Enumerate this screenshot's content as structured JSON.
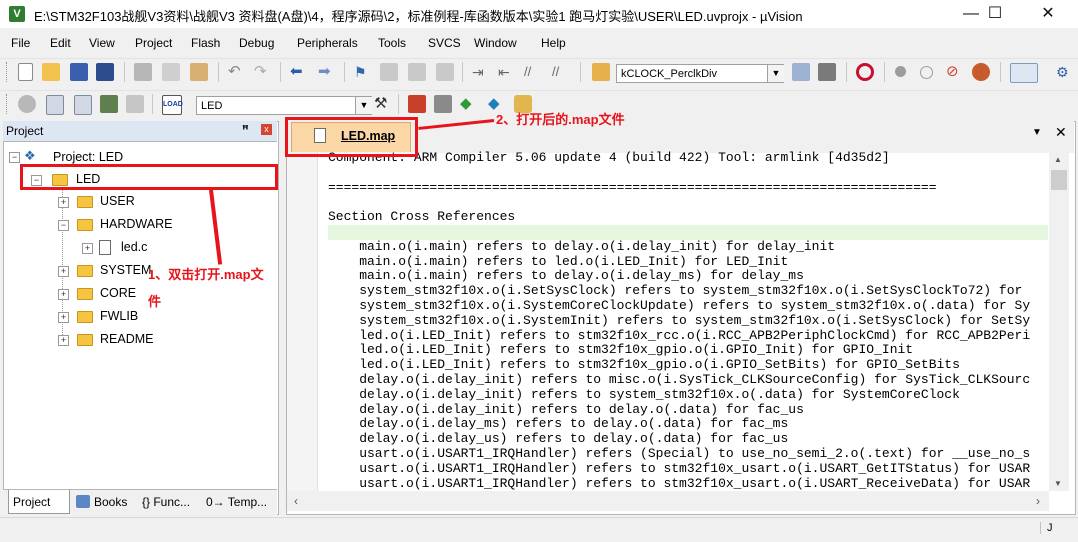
{
  "window": {
    "title": "E:\\STM32F103战舰V3资料\\战舰V3 资料盘(A盘)\\4，程序源码\\2，标准例程-库函数版本\\实验1 跑马灯实验\\USER\\LED.uvprojx - µVision",
    "app_icon_text": "V",
    "minimize": "—",
    "maximize": "☐",
    "close": "✕"
  },
  "menu": [
    "File",
    "Edit",
    "View",
    "Project",
    "Flash",
    "Debug",
    "Peripherals",
    "Tools",
    "SVCS",
    "Window",
    "Help"
  ],
  "toolbar1": {
    "target_combo": "kCLOCK_PerclkDiv"
  },
  "toolbar2": {
    "target_select": "LED",
    "load_label": "LOAD"
  },
  "project_panel": {
    "title": "Project",
    "pin": "ᵦ",
    "close": "x",
    "root": "Project: LED",
    "target": "LED",
    "groups": [
      "USER",
      "HARDWARE",
      "SYSTEM",
      "CORE",
      "FWLIB",
      "README"
    ],
    "hardware_file": "led.c"
  },
  "bottom_tabs": [
    "Project",
    "Books",
    "{} Func...",
    "0→ Temp..."
  ],
  "editor": {
    "tab_label": "LED.map",
    "lines": [
      "Component: ARM Compiler 5.06 update 4 (build 422) Tool: armlink [4d35d2]",
      "",
      "==============================================================================",
      "",
      "Section Cross References",
      "",
      "    main.o(i.main) refers to delay.o(i.delay_init) for delay_init",
      "    main.o(i.main) refers to led.o(i.LED_Init) for LED_Init",
      "    main.o(i.main) refers to delay.o(i.delay_ms) for delay_ms",
      "    system_stm32f10x.o(i.SetSysClock) refers to system_stm32f10x.o(i.SetSysClockTo72) for",
      "    system_stm32f10x.o(i.SystemCoreClockUpdate) refers to system_stm32f10x.o(.data) for Sy",
      "    system_stm32f10x.o(i.SystemInit) refers to system_stm32f10x.o(i.SetSysClock) for SetSy",
      "    led.o(i.LED_Init) refers to stm32f10x_rcc.o(i.RCC_APB2PeriphClockCmd) for RCC_APB2Peri",
      "    led.o(i.LED_Init) refers to stm32f10x_gpio.o(i.GPIO_Init) for GPIO_Init",
      "    led.o(i.LED_Init) refers to stm32f10x_gpio.o(i.GPIO_SetBits) for GPIO_SetBits",
      "    delay.o(i.delay_init) refers to misc.o(i.SysTick_CLKSourceConfig) for SysTick_CLKSourc",
      "    delay.o(i.delay_init) refers to system_stm32f10x.o(.data) for SystemCoreClock",
      "    delay.o(i.delay_init) refers to delay.o(.data) for fac_us",
      "    delay.o(i.delay_ms) refers to delay.o(.data) for fac_ms",
      "    delay.o(i.delay_us) refers to delay.o(.data) for fac_us",
      "    usart.o(i.USART1_IRQHandler) refers (Special) to use_no_semi_2.o(.text) for __use_no_s",
      "    usart.o(i.USART1_IRQHandler) refers to stm32f10x_usart.o(i.USART_GetITStatus) for USAR",
      "    usart.o(i.USART1_IRQHandler) refers to stm32f10x_usart.o(i.USART_ReceiveData) for USAR"
    ]
  },
  "annotations": {
    "step1_line1": "1、双击打开.map文",
    "step1_line2": "件",
    "step2": "2、打开后的.map文件"
  },
  "status": {
    "right_indicator": "J"
  },
  "colors": {
    "annotation_red": "#e8141c",
    "active_tab": "#fbd6a7",
    "highlight_line": "#e6f7e0"
  }
}
